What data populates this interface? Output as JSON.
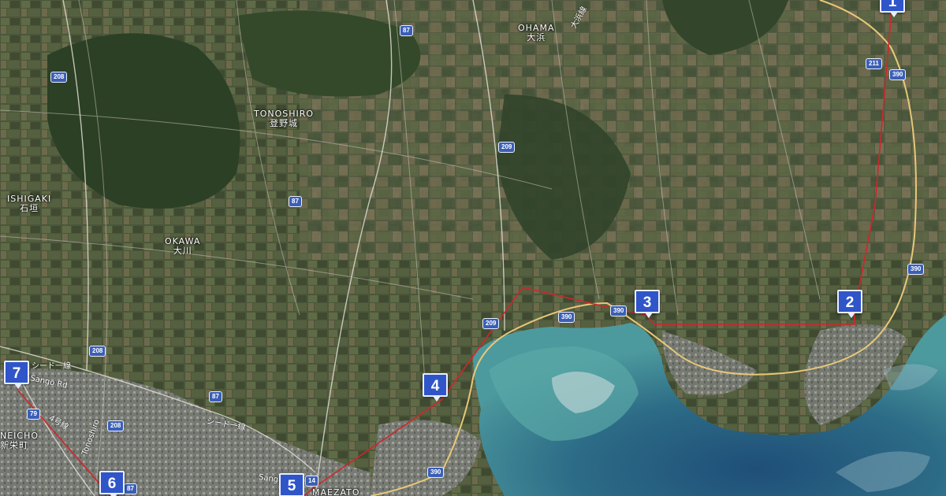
{
  "places": [
    {
      "id": "ohama",
      "en": "OHAMA",
      "jp": "大浜"
    },
    {
      "id": "tonoshiro",
      "en": "TONOSHIRO",
      "jp": "登野城"
    },
    {
      "id": "ishigaki",
      "en": "ISHIGAKI",
      "jp": "石垣"
    },
    {
      "id": "okawa",
      "en": "OKAWA",
      "jp": "大川"
    },
    {
      "id": "shineicho",
      "en": "NEICHO",
      "jp": "新栄町"
    },
    {
      "id": "maezato",
      "en": "MAEZATO",
      "jp": ""
    }
  ],
  "road_shields": [
    "87",
    "208",
    "211",
    "390",
    "390",
    "209",
    "390",
    "209",
    "208",
    "87",
    "208",
    "87",
    "390",
    "14",
    "79",
    "87"
  ],
  "road_labels": [
    "シード一線",
    "Sango Rd",
    "4号線",
    "Tonoshiro",
    "シード一線",
    "Sango",
    "大浜線"
  ],
  "markers": [
    {
      "number": "1"
    },
    {
      "number": "2"
    },
    {
      "number": "3"
    },
    {
      "number": "4"
    },
    {
      "number": "5"
    },
    {
      "number": "6"
    },
    {
      "number": "7"
    }
  ],
  "colors": {
    "route": "#d0262c",
    "highway": "#e8c878",
    "marker": "#2f55c9",
    "sea_shallow": "#4d9a9e",
    "sea_deep": "#1f4f78"
  }
}
